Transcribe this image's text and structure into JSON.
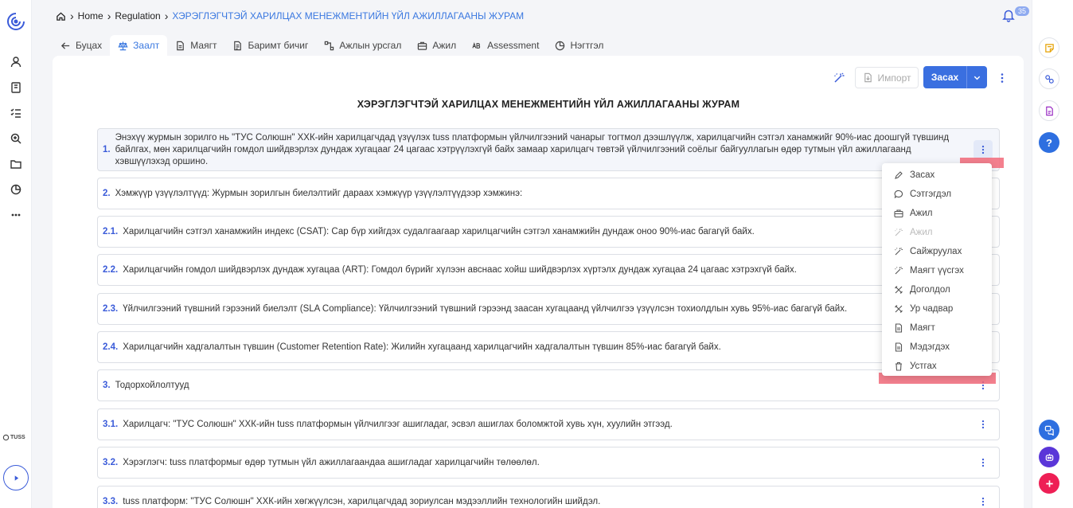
{
  "breadcrumb": {
    "home": "Home",
    "section": "Regulation",
    "current": "ХЭРЭГЛЭГЧТЭЙ ХАРИЛЦАХ МЕНЕЖМЕНТИЙН ҮЙЛ АЖИЛЛАГААНЫ ЖУРАМ"
  },
  "notifications": {
    "count": "35"
  },
  "tabs": [
    {
      "label": "Буцах",
      "icon": "arrow-left-icon"
    },
    {
      "label": "Заалт",
      "icon": "scale-icon",
      "active": true
    },
    {
      "label": "Маягт",
      "icon": "document-icon"
    },
    {
      "label": "Баримт бичиг",
      "icon": "file-icon"
    },
    {
      "label": "Ажлын урсгал",
      "icon": "workflow-icon"
    },
    {
      "label": "Ажил",
      "icon": "briefcase-icon"
    },
    {
      "label": "Assessment",
      "icon": "abc-icon"
    },
    {
      "label": "Нэгтгэл",
      "icon": "chart-pie-icon"
    }
  ],
  "toolbar": {
    "import_label": "Импорт",
    "edit_label": "Засах"
  },
  "document": {
    "title": "ХЭРЭГЛЭГЧТЭЙ ХАРИЛЦАХ МЕНЕЖМЕНТИЙН ҮЙЛ АЖИЛЛАГААНЫ ЖУРАМ",
    "items": [
      {
        "num": "1.",
        "text": "Энэхүү журмын зорилго нь \"ТУС Солюшн\" ХХК-ийн харилцагчдад үзүүлэх tuss платформын үйлчилгээний чанарыг тогтмол дээшлүүлж, харилцагчийн сэтгэл ханамжийг 90%-иас доошгүй түвшинд байлгах, мөн харилцагчийн гомдол шийдвэрлэх дундаж хугацааг 24 цагаас хэтрүүлэхгүй байх замаар харилцагч төвтэй үйлчилгээний соёлыг байгууллагын өдөр тутмын үйл ажиллагаанд хэвшүүлэхэд оршино."
      },
      {
        "num": "2.",
        "text": "Хэмжүүр үзүүлэлтүүд: Журмын зорилгын биелэлтийг дараах хэмжүүр үзүүлэлтүүдээр хэмжинэ:"
      },
      {
        "num": "2.1.",
        "text": "Харилцагчийн сэтгэл ханамжийн индекс (CSAT): Сар бүр хийгдэх судалгаагаар харилцагчийн сэтгэл ханамжийн дундаж оноо 90%-иас багагүй байх."
      },
      {
        "num": "2.2.",
        "text": "Харилцагчийн гомдол шийдвэрлэх дундаж хугацаа (ART): Гомдол бүрийг хүлээн авснаас хойш шийдвэрлэх хүртэлх дундаж хугацаа 24 цагаас хэтрэхгүй байх."
      },
      {
        "num": "2.3.",
        "text": "Үйлчилгээний түвшний гэрээний биелэлт (SLA Compliance): Үйлчилгээний түвшний гэрээнд заасан хугацаанд үйлчилгээ үзүүлсэн тохиолдлын хувь 95%-иас багагүй байх."
      },
      {
        "num": "2.4.",
        "text": "Харилцагчийн хадгалалтын түвшин (Customer Retention Rate): Жилийн хугацаанд харилцагчийн хадгалалтын түвшин 85%-иас багагүй байх."
      },
      {
        "num": "3.",
        "text": "Тодорхойлолтууд"
      },
      {
        "num": "3.1.",
        "text": "Харилцагч: \"ТУС Солюшн\" ХХК-ийн tuss платформын үйлчилгээг ашигладаг, эсвэл ашиглах боломжтой хувь хүн, хуулийн этгээд."
      },
      {
        "num": "3.2.",
        "text": "Хэрэглэгч: tuss платформыг өдөр тутмын үйл ажиллагаандаа ашигладаг харилцагчийн төлөөлөл."
      },
      {
        "num": "3.3.",
        "text": "tuss платформ: \"ТУС Солюшн\" ХХК-ийн хөгжүүлсэн, харилцагчдад зориулсан мэдээллийн технологийн шийдэл."
      }
    ]
  },
  "context_menu": [
    {
      "label": "Засах",
      "icon": "pencil-icon"
    },
    {
      "label": "Сэтгэгдэл",
      "icon": "comment-icon"
    },
    {
      "label": "Ажил",
      "icon": "briefcase-icon"
    },
    {
      "label": "Ажил",
      "icon": "magic-wand-icon",
      "disabled": true
    },
    {
      "label": "Сайжруулах",
      "icon": "magic-wand-icon"
    },
    {
      "label": "Маягт үүсгэх",
      "icon": "magic-wand-icon"
    },
    {
      "label": "Доголдол",
      "icon": "tools-icon"
    },
    {
      "label": "Ур чадвар",
      "icon": "tools-icon"
    },
    {
      "label": "Маягт",
      "icon": "document-icon"
    },
    {
      "label": "Мэдэгдэх",
      "icon": "document-icon"
    },
    {
      "label": "Устгах",
      "icon": "trash-icon"
    }
  ],
  "brand": {
    "name": "TUSS"
  },
  "colors": {
    "accent": "#3a6fe0",
    "highlight": "#f26a7a",
    "add_button": "#ee1f55"
  }
}
